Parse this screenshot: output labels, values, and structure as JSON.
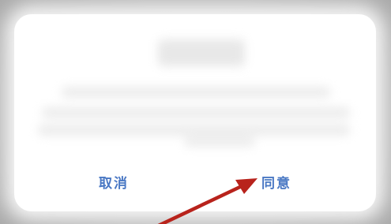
{
  "dialog": {
    "cancel_label": "取消",
    "agree_label": "同意"
  },
  "annotation": {
    "arrow_color": "#b8231c"
  },
  "colors": {
    "button_text": "#4a78c4",
    "dialog_bg": "#ffffff",
    "backdrop": "#c6c6c6"
  }
}
